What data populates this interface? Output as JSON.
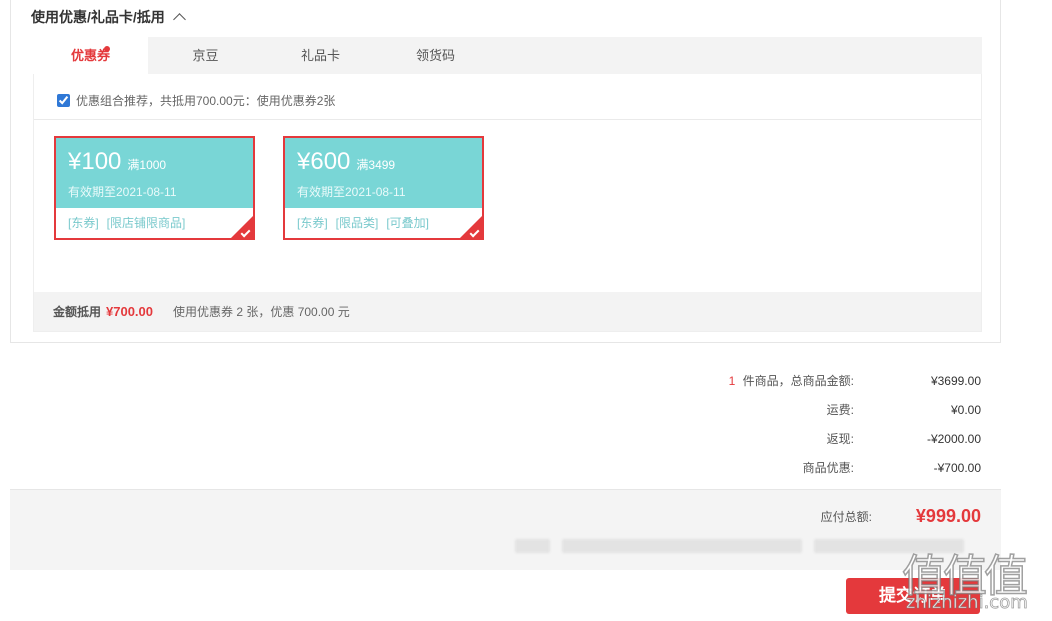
{
  "section": {
    "title": "使用优惠/礼品卡/抵用"
  },
  "tabs": [
    {
      "label": "优惠券"
    },
    {
      "label": "京豆"
    },
    {
      "label": "礼品卡"
    },
    {
      "label": "领货码"
    }
  ],
  "recommend": {
    "text": "优惠组合推荐，共抵用700.00元：使用优惠券2张",
    "checked": true
  },
  "coupons": [
    {
      "currency": "¥",
      "amount": "100",
      "condition": "满1000",
      "validity": "有效期至2021-08-11",
      "tags": [
        "[东券]",
        "[限店铺限商品]"
      ],
      "selected": true
    },
    {
      "currency": "¥",
      "amount": "600",
      "condition": "满3499",
      "validity": "有效期至2021-08-11",
      "tags": [
        "[东券]",
        "[限品类]",
        "[可叠加]"
      ],
      "selected": true
    }
  ],
  "discount_summary": {
    "label": "金额抵用",
    "amount": "¥700.00",
    "description": "使用优惠券 2 张，优惠 700.00 元"
  },
  "totals": {
    "item_count": "1",
    "items_label": " 件商品，总商品金额:",
    "items_value": "¥3699.00",
    "shipping_label": "运费:",
    "shipping_value": "¥0.00",
    "cashback_label": "返现:",
    "cashback_value": "-¥2000.00",
    "discount_label": "商品优惠:",
    "discount_value": "-¥700.00"
  },
  "payable": {
    "label": "应付总额:",
    "amount": "¥999.00"
  },
  "submit": {
    "label": "提交订单"
  },
  "watermark": {
    "big": "值值值",
    "small": "zhizhizhi.com"
  },
  "colors": {
    "accent": "#e4393c",
    "coupon_bg": "#79d6d6",
    "tag": "#79c9cc"
  }
}
